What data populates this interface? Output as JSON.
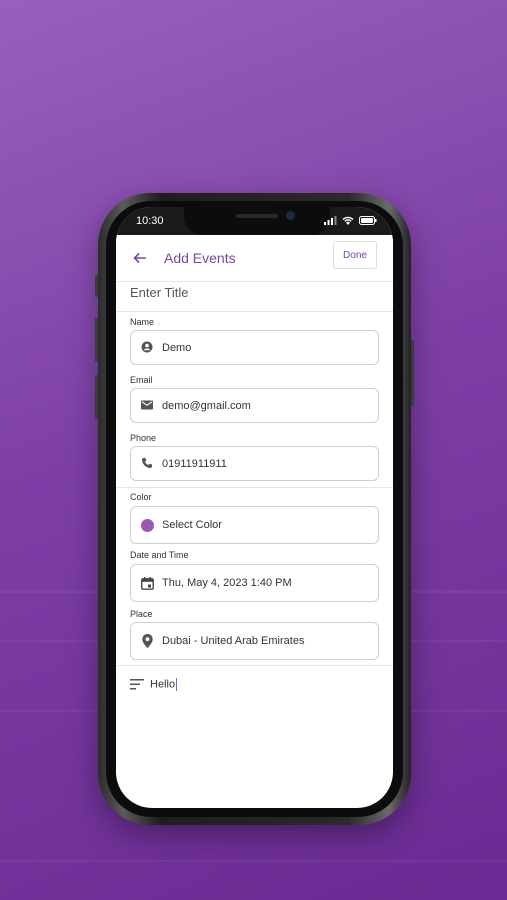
{
  "status_bar": {
    "time": "10:30"
  },
  "app_bar": {
    "title": "Add Events",
    "done_label": "Done"
  },
  "form": {
    "title_placeholder": "Enter Title",
    "fields": [
      {
        "label": "Name",
        "value": "Demo",
        "icon": "person-icon"
      },
      {
        "label": "Email",
        "value": "demo@gmail.com",
        "icon": "mail-icon"
      },
      {
        "label": "Phone",
        "value": "01911911911",
        "icon": "phone-icon"
      },
      {
        "label": "Color",
        "value": "Select Color",
        "icon": "color-swatch-icon"
      },
      {
        "label": "Date and Time",
        "value": "Thu, May 4, 2023 1:40 PM",
        "icon": "calendar-icon"
      },
      {
        "label": "Place",
        "value": "Dubai - United Arab Emirates",
        "icon": "location-pin-icon"
      }
    ],
    "notes": {
      "value": "Hello",
      "icon": "notes-icon"
    }
  },
  "colors": {
    "accent": "#7a45a8",
    "selected_color": "#9b59b6",
    "background": "#7d3fa6"
  }
}
